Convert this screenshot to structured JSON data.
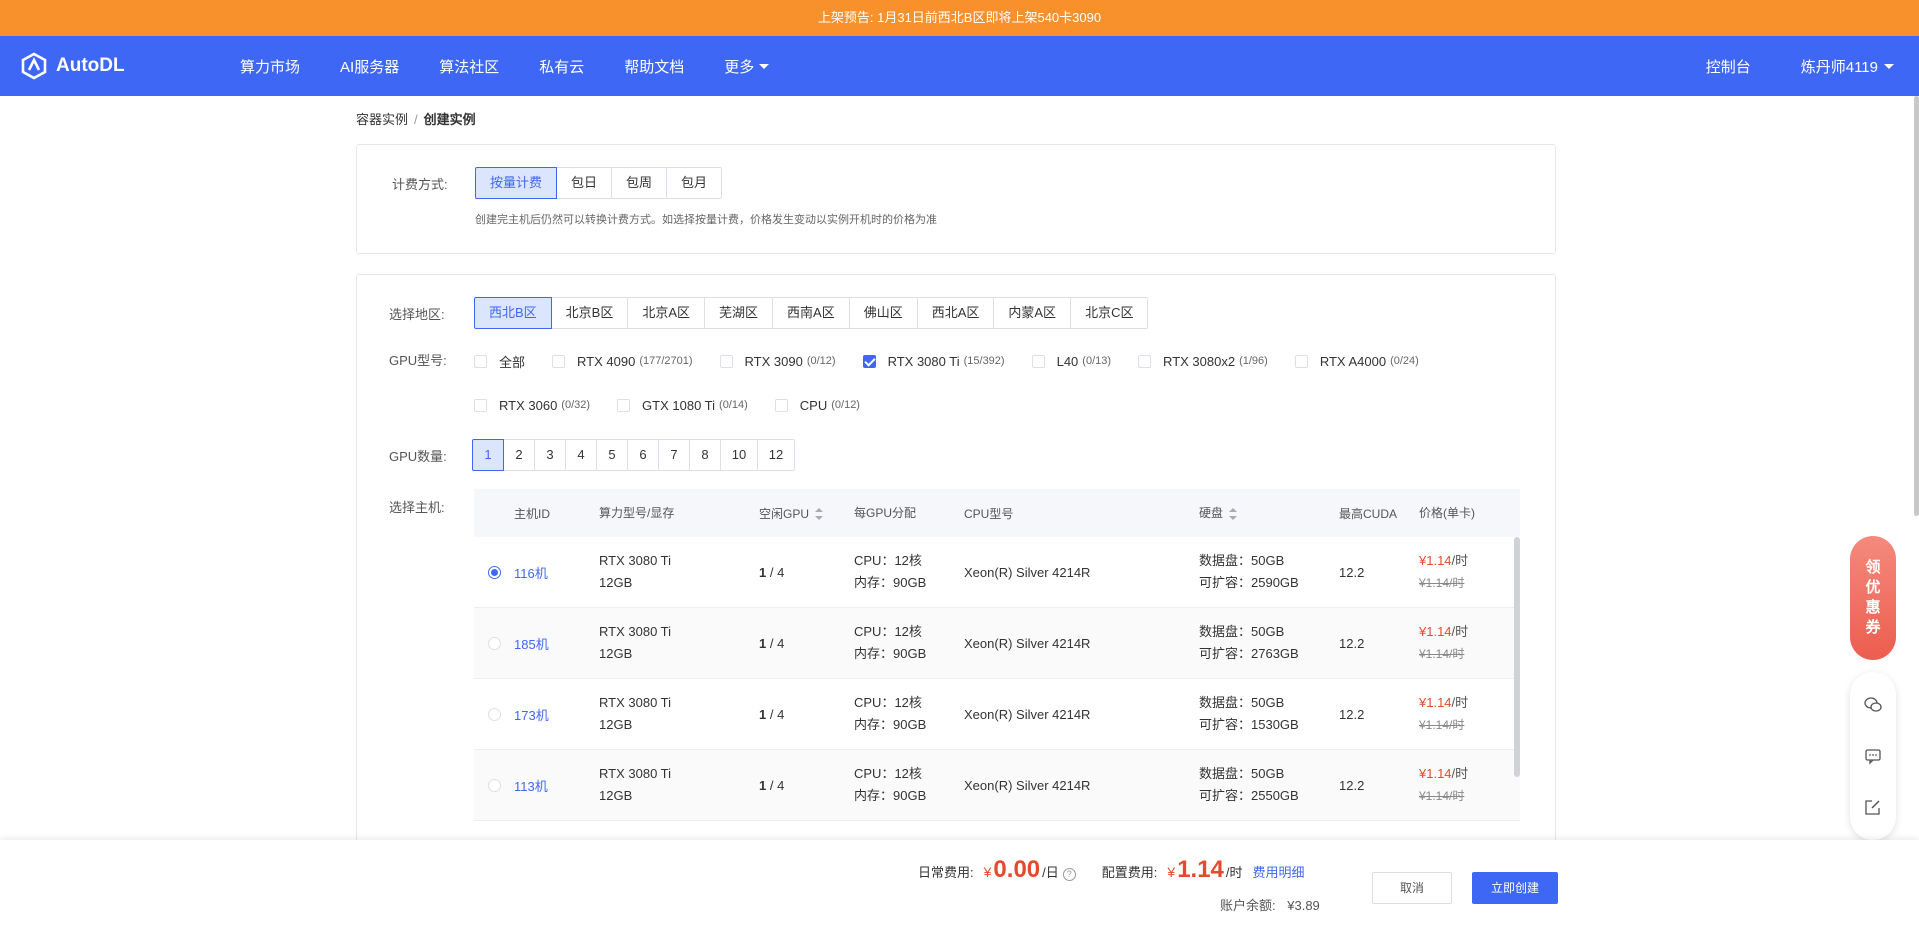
{
  "notice": "上架预告: 1月31日前西北B区即将上架540卡3090",
  "brand": {
    "name": "AutoDL"
  },
  "nav": {
    "items": [
      "算力市场",
      "AI服务器",
      "算法社区",
      "私有云",
      "帮助文档",
      "更多"
    ],
    "console": "控制台",
    "user": "炼丹师4119"
  },
  "breadcrumb": {
    "parent": "容器实例",
    "sep": "/",
    "current": "创建实例"
  },
  "billing": {
    "label": "计费方式:",
    "options": [
      "按量计费",
      "包日",
      "包周",
      "包月"
    ],
    "active": 0,
    "hint": "创建完主机后仍然可以转换计费方式。如选择按量计费，价格发生变动以实例开机时的价格为准"
  },
  "region": {
    "label": "选择地区:",
    "options": [
      "西北B区",
      "北京B区",
      "北京A区",
      "芜湖区",
      "西南A区",
      "佛山区",
      "西北A区",
      "内蒙A区",
      "北京C区"
    ],
    "active": 0
  },
  "gpu": {
    "label": "GPU型号:",
    "options": [
      {
        "name": "全部",
        "count": "",
        "checked": false
      },
      {
        "name": "RTX 4090",
        "count": "(177/2701)",
        "checked": false
      },
      {
        "name": "RTX 3090",
        "count": "(0/12)",
        "checked": false
      },
      {
        "name": "RTX 3080 Ti",
        "count": "(15/392)",
        "checked": true
      },
      {
        "name": "L40",
        "count": "(0/13)",
        "checked": false
      },
      {
        "name": "RTX 3080x2",
        "count": "(1/96)",
        "checked": false
      },
      {
        "name": "RTX A4000",
        "count": "(0/24)",
        "checked": false
      },
      {
        "name": "RTX 3060",
        "count": "(0/32)",
        "checked": false
      },
      {
        "name": "GTX 1080 Ti",
        "count": "(0/14)",
        "checked": false
      },
      {
        "name": "CPU",
        "count": "(0/12)",
        "checked": false
      }
    ]
  },
  "gpu_count": {
    "label": "GPU数量:",
    "options": [
      "1",
      "2",
      "3",
      "4",
      "5",
      "6",
      "7",
      "8",
      "10",
      "12"
    ],
    "active": 0
  },
  "hosts": {
    "label": "选择主机:",
    "headers": [
      "主机ID",
      "算力型号/显存",
      "空闲GPU",
      "每GPU分配",
      "CPU型号",
      "硬盘",
      "最高CUDA",
      "价格(单卡)"
    ],
    "rows": [
      {
        "id": "116机",
        "model": "RTX 3080 Ti",
        "mem": "12GB",
        "free": "1",
        "total": " / 4",
        "cpu": "CPU：12核",
        "ram": "内存：90GB",
        "cpu_model": "Xeon(R) Silver 4214R",
        "disk": "数据盘：50GB",
        "expand": "可扩容：2590GB",
        "cuda": "12.2",
        "price": "1.14",
        "unit": "/时",
        "old": "¥1.14/时",
        "selected": true
      },
      {
        "id": "185机",
        "model": "RTX 3080 Ti",
        "mem": "12GB",
        "free": "1",
        "total": " / 4",
        "cpu": "CPU：12核",
        "ram": "内存：90GB",
        "cpu_model": "Xeon(R) Silver 4214R",
        "disk": "数据盘：50GB",
        "expand": "可扩容：2763GB",
        "cuda": "12.2",
        "price": "1.14",
        "unit": "/时",
        "old": "¥1.14/时",
        "selected": false
      },
      {
        "id": "173机",
        "model": "RTX 3080 Ti",
        "mem": "12GB",
        "free": "1",
        "total": " / 4",
        "cpu": "CPU：12核",
        "ram": "内存：90GB",
        "cpu_model": "Xeon(R) Silver 4214R",
        "disk": "数据盘：50GB",
        "expand": "可扩容：1530GB",
        "cuda": "12.2",
        "price": "1.14",
        "unit": "/时",
        "old": "¥1.14/时",
        "selected": false
      },
      {
        "id": "113机",
        "model": "RTX 3080 Ti",
        "mem": "12GB",
        "free": "1",
        "total": " / 4",
        "cpu": "CPU：12核",
        "ram": "内存：90GB",
        "cpu_model": "Xeon(R) Silver 4214R",
        "disk": "数据盘：50GB",
        "expand": "可扩容：2550GB",
        "cuda": "12.2",
        "price": "1.14",
        "unit": "/时",
        "old": "¥1.14/时",
        "selected": false
      }
    ]
  },
  "footer": {
    "daily_label": "日常费用:",
    "daily_yen": "¥",
    "daily_value": "0.00",
    "daily_unit": "/日",
    "config_label": "配置费用:",
    "config_yen": "¥",
    "config_value": "1.14",
    "config_unit": "/时",
    "detail_link": "费用明细",
    "balance_label": "账户余额:",
    "balance_value": "¥3.89",
    "cancel": "取消",
    "create": "立即创建"
  },
  "float": {
    "coupon": [
      "领",
      "优",
      "惠",
      "券"
    ]
  },
  "colors": {
    "primary": "#3f67f6",
    "notice": "#f8902c",
    "price": "#e64a2e"
  }
}
